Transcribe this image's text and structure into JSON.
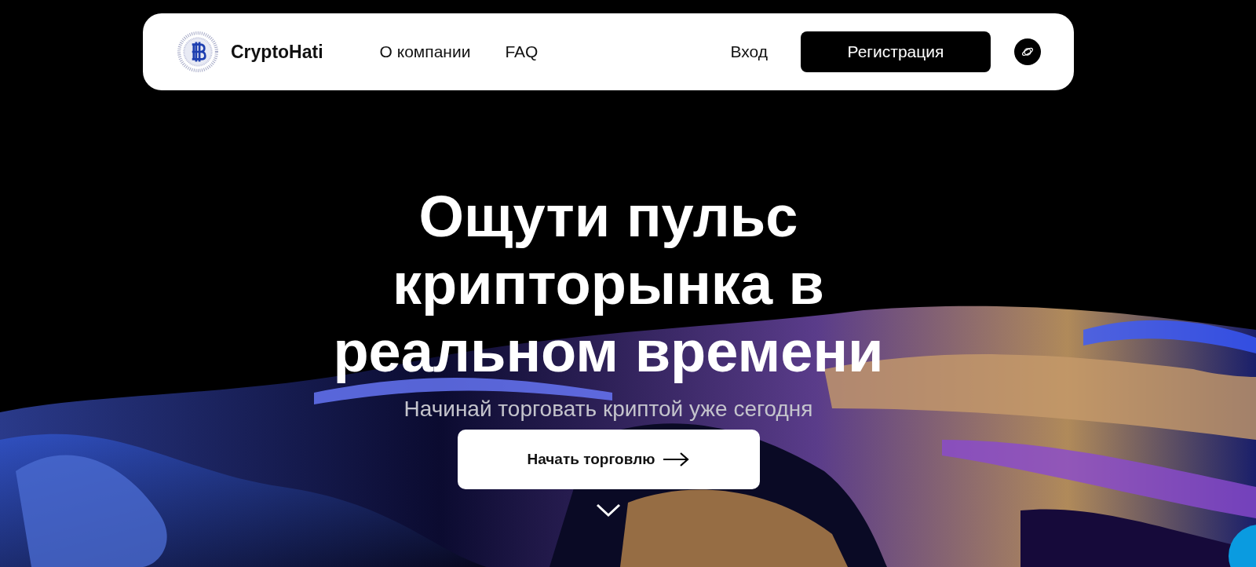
{
  "header": {
    "brand": "CryptoHati",
    "nav": [
      {
        "label": "О компании"
      },
      {
        "label": "FAQ"
      }
    ],
    "login": "Вход",
    "register": "Регистрация"
  },
  "hero": {
    "title_lines": [
      "Ощути пульс",
      "крипторынка в",
      "реальном времени"
    ],
    "subtitle": "Начинай торговать криптой уже сегодня",
    "cta": "Начать торговлю"
  }
}
